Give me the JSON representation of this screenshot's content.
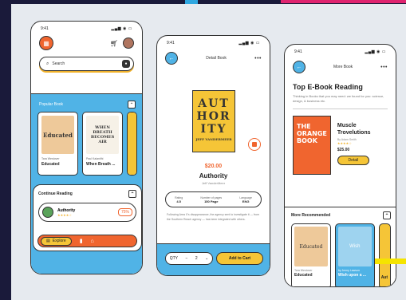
{
  "colors": {
    "orange": "#f0652f",
    "blue": "#50b3e6",
    "yellow": "#f5c537",
    "pink": "#e0246f"
  },
  "phone1": {
    "status_time": "9:41",
    "status_icons": "▂▄▆ ◉ ▭",
    "search_placeholder": "Search",
    "popular_label": "Popular Book",
    "books": [
      {
        "cover_text": "Educated",
        "sub": "Tara Westover",
        "title": "Educated"
      },
      {
        "cover_text": "WHEN BREATH BECOMES AIR",
        "sub": "Paul Kalanithi",
        "title": "When Breath ..."
      }
    ],
    "continue_label": "Continue Reading",
    "continue_item": {
      "title": "Authority",
      "stars": "★★★★☆",
      "percent": "75%"
    },
    "tab_explore": "Explore"
  },
  "phone2": {
    "status_time": "9:41",
    "status_icons": "▂▄▆ ◉ ▭",
    "header_title": "Detail Book",
    "cover_lines": [
      "AUT",
      "HOR",
      "ITY"
    ],
    "cover_author": "JEFF VANDERMEER",
    "price": "$20.00",
    "name": "Authority",
    "author": "Jeff VanderMeer",
    "stats": [
      {
        "label": "Rating",
        "value": "4.5"
      },
      {
        "label": "Number of pages",
        "value": "150 Page"
      },
      {
        "label": "Language",
        "value": "ENG"
      }
    ],
    "description": "Following Area X's disappearance, the agency sent to investigate it — from the Southern Reach agency — has been integrated with others.",
    "qty_label": "QTY",
    "qty_value": "2",
    "add_to_cart": "Add to Cart"
  },
  "phone3": {
    "status_time": "9:41",
    "status_icons": "▂▄▆ ◉ ▭",
    "header_title": "More Book",
    "heading": "Top E-Book Reading",
    "description": "Thinking in Books that you may need: we found for you: science, design, & business etc.",
    "featured": {
      "cover": "THE ORANGE BOOK",
      "title": "Muscle Trovelutions",
      "author": "By Adam Smith",
      "stars": "★★★★☆",
      "price": "$25.00",
      "button": "Detail"
    },
    "recommended_label": "More Recommended",
    "rec": [
      {
        "cover": "Educated",
        "sub": "Tara Westover",
        "title": "Educated"
      },
      {
        "cover": "Wish",
        "sub": "by Jenny Lawson",
        "title": "Wish upon a ..."
      }
    ],
    "rec_partial_title": "Aut"
  }
}
